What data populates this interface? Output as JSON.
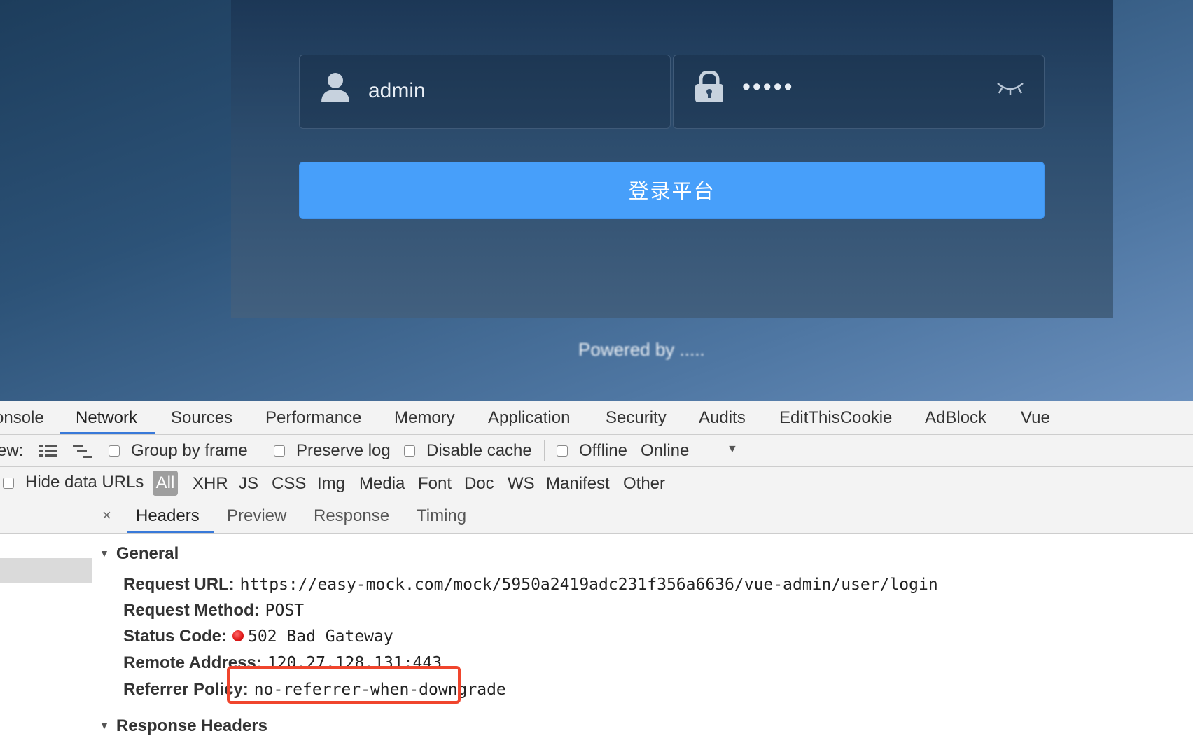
{
  "login": {
    "username": "admin",
    "password_masked": "•••••",
    "submit_label": "登录平台",
    "footer": "Powered by ....."
  },
  "devtools": {
    "tabs": [
      "onsole",
      "Network",
      "Sources",
      "Performance",
      "Memory",
      "Application",
      "Security",
      "Audits",
      "EditThisCookie",
      "AdBlock",
      "Vue"
    ],
    "active_tab": "Network",
    "toolbar": {
      "view_label": "ew:",
      "group_by_frame": "Group by frame",
      "preserve_log": "Preserve log",
      "disable_cache": "Disable cache",
      "offline": "Offline",
      "throttle": "Online",
      "dropdown_arrow": "▼"
    },
    "filter": {
      "hide_data_urls": "Hide data URLs",
      "types": [
        "All",
        "XHR",
        "JS",
        "CSS",
        "Img",
        "Media",
        "Font",
        "Doc",
        "WS",
        "Manifest",
        "Other"
      ]
    },
    "detail_tabs": [
      "Headers",
      "Preview",
      "Response",
      "Timing"
    ],
    "close_glyph": "×",
    "general": {
      "title": "General",
      "request_url_key": "Request URL:",
      "request_url": "https://easy-mock.com/mock/5950a2419adc231f356a6636/vue-admin/user/login",
      "request_method_key": "Request Method:",
      "request_method": "POST",
      "status_code_key": "Status Code:",
      "status_code": "502 Bad Gateway",
      "remote_address_key": "Remote Address:",
      "remote_address": "120.27.128.131:443",
      "referrer_policy_key": "Referrer Policy:",
      "referrer_policy": "no-referrer-when-downgrade"
    },
    "response_headers_title": "Response Headers",
    "colors": {
      "status_error": "#e21b1b",
      "highlight": "#f0452d",
      "accent": "#3879d9",
      "login_button": "#479ffa"
    }
  }
}
